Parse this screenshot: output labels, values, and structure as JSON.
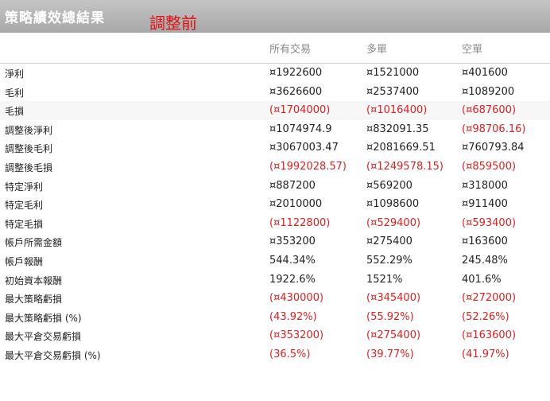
{
  "title": "策略績效總結果",
  "title_note": "調整前",
  "columns": [
    "所有交易",
    "多單",
    "空單"
  ],
  "rows": [
    {
      "label": "淨利",
      "values": [
        "¤1922600",
        "¤1521000",
        "¤401600"
      ],
      "negative": [
        false,
        false,
        false
      ]
    },
    {
      "label": "毛利",
      "values": [
        "¤3626600",
        "¤2537400",
        "¤1089200"
      ],
      "negative": [
        false,
        false,
        false
      ]
    },
    {
      "label": "毛損",
      "values": [
        "(¤1704000)",
        "(¤1016400)",
        "(¤687600)"
      ],
      "negative": [
        true,
        true,
        true
      ]
    },
    {
      "label": "調整後淨利",
      "values": [
        "¤1074974.9",
        "¤832091.35",
        "(¤98706.16)"
      ],
      "negative": [
        false,
        false,
        true
      ]
    },
    {
      "label": "調整後毛利",
      "values": [
        "¤3067003.47",
        "¤2081669.51",
        "¤760793.84"
      ],
      "negative": [
        false,
        false,
        false
      ]
    },
    {
      "label": "調整後毛損",
      "values": [
        "(¤1992028.57)",
        "(¤1249578.15)",
        "(¤859500)"
      ],
      "negative": [
        true,
        true,
        true
      ]
    },
    {
      "label": "特定淨利",
      "values": [
        "¤887200",
        "¤569200",
        "¤318000"
      ],
      "negative": [
        false,
        false,
        false
      ]
    },
    {
      "label": "特定毛利",
      "values": [
        "¤2010000",
        "¤1098600",
        "¤911400"
      ],
      "negative": [
        false,
        false,
        false
      ]
    },
    {
      "label": "特定毛損",
      "values": [
        "(¤1122800)",
        "(¤529400)",
        "(¤593400)"
      ],
      "negative": [
        true,
        true,
        true
      ]
    },
    {
      "label": "帳戶所需金額",
      "values": [
        "¤353200",
        "¤275400",
        "¤163600"
      ],
      "negative": [
        false,
        false,
        false
      ]
    },
    {
      "label": "帳戶報酬",
      "values": [
        "544.34%",
        "552.29%",
        "245.48%"
      ],
      "negative": [
        false,
        false,
        false
      ]
    },
    {
      "label": "初始資本報酬",
      "values": [
        "1922.6%",
        "1521%",
        "401.6%"
      ],
      "negative": [
        false,
        false,
        false
      ]
    },
    {
      "label": "最大策略虧損",
      "values": [
        "(¤430000)",
        "(¤345400)",
        "(¤272000)"
      ],
      "negative": [
        true,
        true,
        true
      ]
    },
    {
      "label": "最大策略虧損 (%)",
      "values": [
        "(43.92%)",
        "(55.92%)",
        "(52.26%)"
      ],
      "negative": [
        true,
        true,
        true
      ]
    },
    {
      "label": "最大平倉交易虧損",
      "values": [
        "(¤353200)",
        "(¤275400)",
        "(¤163600)"
      ],
      "negative": [
        true,
        true,
        true
      ]
    },
    {
      "label": "最大平倉交易虧損 (%)",
      "values": [
        "(36.5%)",
        "(39.77%)",
        "(41.97%)"
      ],
      "negative": [
        true,
        true,
        true
      ]
    }
  ],
  "colors": {
    "negative": "#e02020",
    "title_note": "#e01010",
    "header_bg": "#b3b3b3"
  }
}
